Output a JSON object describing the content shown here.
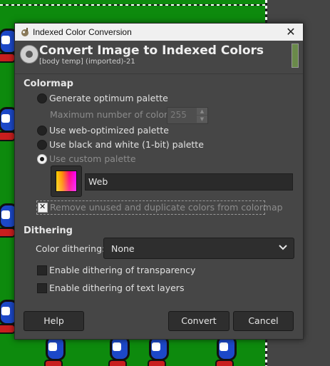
{
  "window": {
    "title": "Indexed Color Conversion",
    "close_glyph": "✕"
  },
  "header": {
    "title": "Convert Image to Indexed Colors",
    "subtitle": "[body temp] (imported)-21"
  },
  "colormap": {
    "section_title": "Colormap",
    "options": [
      {
        "label": "Generate optimum palette",
        "selected": false
      },
      {
        "label": "Use web-optimized palette",
        "selected": false
      },
      {
        "label": "Use black and white (1-bit) palette",
        "selected": false
      },
      {
        "label": "Use custom palette",
        "selected": true
      }
    ],
    "max_colors_label": "Maximum number of colors:",
    "max_colors_value": "255",
    "custom_palette_name": "Web",
    "remove_unused_label": "Remove unused and duplicate colors from colormap",
    "remove_unused_checked": true
  },
  "dithering": {
    "section_title": "Dithering",
    "color_dithering_label": "Color dithering:",
    "color_dithering_value": "None",
    "transparency_label": "Enable dithering of transparency",
    "transparency_checked": false,
    "text_layers_label": "Enable dithering of text layers",
    "text_layers_checked": false
  },
  "buttons": {
    "help": "Help",
    "convert": "Convert",
    "cancel": "Cancel"
  },
  "icons": {
    "window": "gimp-wilber-icon",
    "header": "convert-indexed-icon",
    "palette": "palette-swatch-icon",
    "dropdown": "chevron-down-icon"
  },
  "colors": {
    "dialog_bg": "#464646",
    "canvas_green": "#0d8a0d"
  }
}
